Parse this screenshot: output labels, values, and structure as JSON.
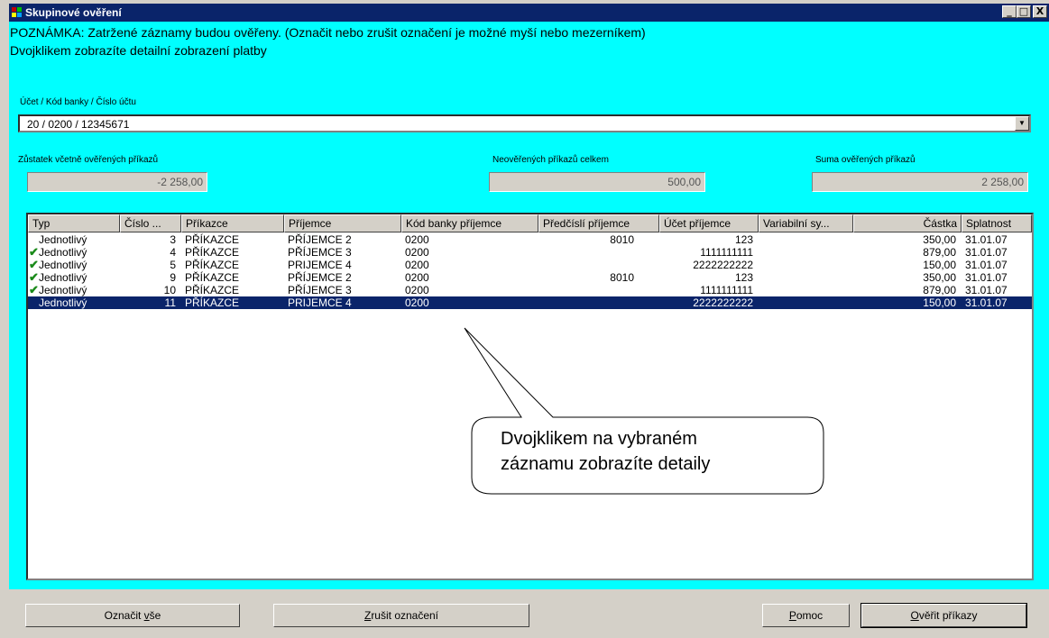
{
  "window": {
    "title": "Skupinové ověření",
    "buttons": {
      "minimize": "_",
      "maximize": "□",
      "close": "X"
    }
  },
  "notes": {
    "line1": "POZNÁMKA: Zatržené záznamy budou ověřeny. (Označit nebo zrušit označení je možné myší nebo mezerníkem)",
    "line2": "Dvojklikem zobrazíte detailní zobrazení platby"
  },
  "account": {
    "label": "Účet / Kód banky / Číslo účtu",
    "value": "20 / 0200 / 12345671"
  },
  "summary": {
    "balance_label": "Zůstatek včetně ověřených příkazů",
    "balance_value": "-2 258,00",
    "unverified_label": "Neověřených příkazů celkem",
    "unverified_value": "500,00",
    "verified_sum_label": "Suma ověřených příkazů",
    "verified_sum_value": "2 258,00"
  },
  "table": {
    "columns": [
      "Typ",
      "Číslo ...",
      "Příkazce",
      "Příjemce",
      "Kód banky příjemce",
      "Předčíslí příjemce",
      "Účet příjemce",
      "Variabilní sy...",
      "Částka",
      "Splatnost"
    ],
    "rows": [
      {
        "checked": false,
        "selected": false,
        "typ": "Jednotlivý",
        "cislo": "3",
        "prikazce": "PŘÍKAZCE",
        "prijemce": "PŘÍJEMCE 2",
        "kod": "0200",
        "predcisli": "8010",
        "ucet": "123",
        "vs": "",
        "castka": "350,00",
        "splatnost": "31.01.07"
      },
      {
        "checked": true,
        "selected": false,
        "typ": "Jednotlivý",
        "cislo": "4",
        "prikazce": "PŘÍKAZCE",
        "prijemce": "PŘÍJEMCE 3",
        "kod": "0200",
        "predcisli": "",
        "ucet": "1111111111",
        "vs": "",
        "castka": "879,00",
        "splatnost": "31.01.07"
      },
      {
        "checked": true,
        "selected": false,
        "typ": "Jednotlivý",
        "cislo": "5",
        "prikazce": "PŘÍKAZCE",
        "prijemce": "PRIJEMCE 4",
        "kod": "0200",
        "predcisli": "",
        "ucet": "2222222222",
        "vs": "",
        "castka": "150,00",
        "splatnost": "31.01.07"
      },
      {
        "checked": true,
        "selected": false,
        "typ": "Jednotlivý",
        "cislo": "9",
        "prikazce": "PŘÍKAZCE",
        "prijemce": "PŘÍJEMCE 2",
        "kod": "0200",
        "predcisli": "8010",
        "ucet": "123",
        "vs": "",
        "castka": "350,00",
        "splatnost": "31.01.07"
      },
      {
        "checked": true,
        "selected": false,
        "typ": "Jednotlivý",
        "cislo": "10",
        "prikazce": "PŘÍKAZCE",
        "prijemce": "PŘÍJEMCE 3",
        "kod": "0200",
        "predcisli": "",
        "ucet": "1111111111",
        "vs": "",
        "castka": "879,00",
        "splatnost": "31.01.07"
      },
      {
        "checked": false,
        "selected": true,
        "typ": "Jednotlivý",
        "cislo": "11",
        "prikazce": "PŘÍKAZCE",
        "prijemce": "PRIJEMCE 4",
        "kod": "0200",
        "predcisli": "",
        "ucet": "2222222222",
        "vs": "",
        "castka": "150,00",
        "splatnost": "31.01.07"
      }
    ]
  },
  "callout": {
    "line1": "Dvojklikem na vybraném",
    "line2": "záznamu zobrazíte detaily"
  },
  "buttons": {
    "select_all_pre": "Označit ",
    "select_all_key": "v",
    "select_all_post": "še",
    "clear_key": "Z",
    "clear_post": "rušit označení",
    "help_key": "P",
    "help_post": "omoc",
    "verify_key": "O",
    "verify_post": "věřit příkazy"
  },
  "colors": {
    "client_bg": "#00ffff",
    "titlebar": "#0a246a",
    "selection": "#0a246a",
    "check": "#1a8a1a"
  }
}
